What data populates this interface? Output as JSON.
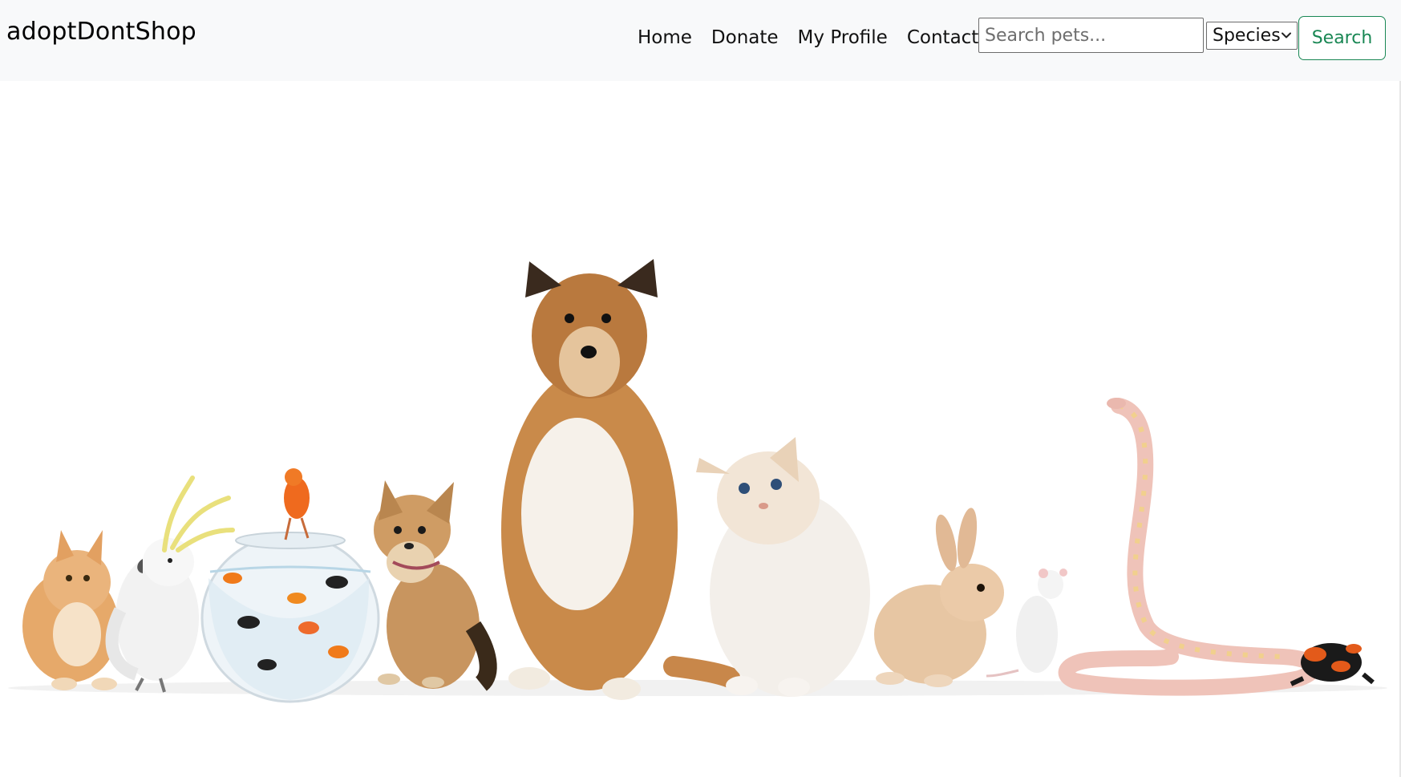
{
  "navbar": {
    "brand": "adoptDontShop",
    "links": [
      {
        "label": "Home"
      },
      {
        "label": "Donate"
      },
      {
        "label": "My Profile"
      },
      {
        "label": "Contact"
      }
    ],
    "search": {
      "placeholder": "Search pets...",
      "value": ""
    },
    "species_select": {
      "selected": "Species",
      "icon": "chevron-down-icon"
    },
    "search_button": "Search"
  },
  "hero": {
    "image": "pets-group-photo",
    "animals": [
      "kitten",
      "cockatoo",
      "fishbowl",
      "canary",
      "goldfish",
      "chihuahua",
      "sheltie-dog",
      "cat",
      "rabbit",
      "rat",
      "snake",
      "frog"
    ]
  },
  "colors": {
    "navbar_bg": "#f8f9fa",
    "search_button": "#198754",
    "page_bg": "#ffffff"
  }
}
